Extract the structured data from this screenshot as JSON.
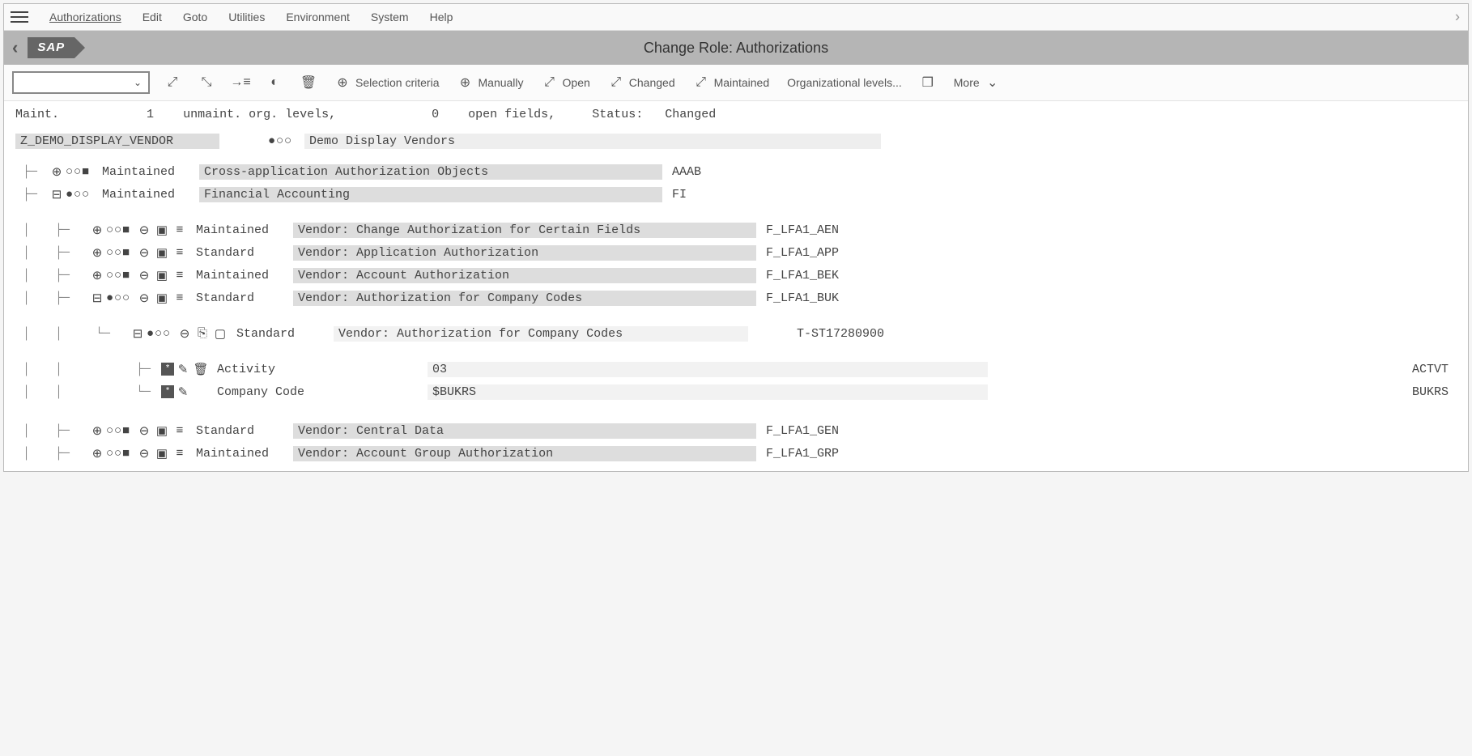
{
  "menu": {
    "items": [
      "Authorizations",
      "Edit",
      "Goto",
      "Utilities",
      "Environment",
      "System",
      "Help"
    ]
  },
  "logo_text": "SAP",
  "title": "Change Role: Authorizations",
  "toolbar": {
    "selection_criteria": "Selection criteria",
    "manually": "Manually",
    "open": "Open",
    "changed": "Changed",
    "maintained": "Maintained",
    "org_levels": "Organizational levels...",
    "more": "More"
  },
  "status_line": {
    "maint_label": "Maint.",
    "maint_count": "1",
    "unmaint_label": "unmaint. org. levels,",
    "open_count": "0",
    "open_label": "open fields,",
    "status_label": "Status:",
    "status_value": "Changed"
  },
  "role": {
    "id": "Z_DEMO_DISPLAY_VENDOR",
    "traffic": "●○○",
    "desc": "Demo Display Vendors"
  },
  "classes": [
    {
      "folder": "⊕",
      "traffic": "○○■",
      "status": "Maintained",
      "desc": "Cross-application Authorization Objects",
      "code": "AAAB"
    },
    {
      "folder": "⊟",
      "traffic": "●○○",
      "status": "Maintained",
      "desc": "Financial Accounting",
      "code": "FI"
    }
  ],
  "objects": [
    {
      "folder": "⊕",
      "traffic": "○○■",
      "status": "Maintained",
      "desc": "Vendor: Change Authorization for Certain Fields",
      "code": "F_LFA1_AEN"
    },
    {
      "folder": "⊕",
      "traffic": "○○■",
      "status": "Standard",
      "desc": "Vendor: Application Authorization",
      "code": "F_LFA1_APP"
    },
    {
      "folder": "⊕",
      "traffic": "○○■",
      "status": "Maintained",
      "desc": "Vendor: Account Authorization",
      "code": "F_LFA1_BEK"
    },
    {
      "folder": "⊟",
      "traffic": "●○○",
      "status": "Standard",
      "desc": "Vendor: Authorization for Company Codes",
      "code": "F_LFA1_BUK"
    }
  ],
  "auth_instance": {
    "folder": "⊟",
    "traffic": "●○○",
    "status": "Standard",
    "desc": "Vendor: Authorization for Company Codes",
    "code": "T-ST17280900"
  },
  "fields": [
    {
      "show_trash": true,
      "name": "Activity",
      "value": "03",
      "tech": "ACTVT"
    },
    {
      "show_trash": false,
      "name": "Company Code",
      "value": "$BUKRS",
      "tech": "BUKRS"
    }
  ],
  "objects_after": [
    {
      "folder": "⊕",
      "traffic": "○○■",
      "status": "Standard",
      "desc": "Vendor: Central Data",
      "code": "F_LFA1_GEN"
    },
    {
      "folder": "⊕",
      "traffic": "○○■",
      "status": "Maintained",
      "desc": "Vendor: Account Group Authorization",
      "code": "F_LFA1_GRP"
    }
  ]
}
